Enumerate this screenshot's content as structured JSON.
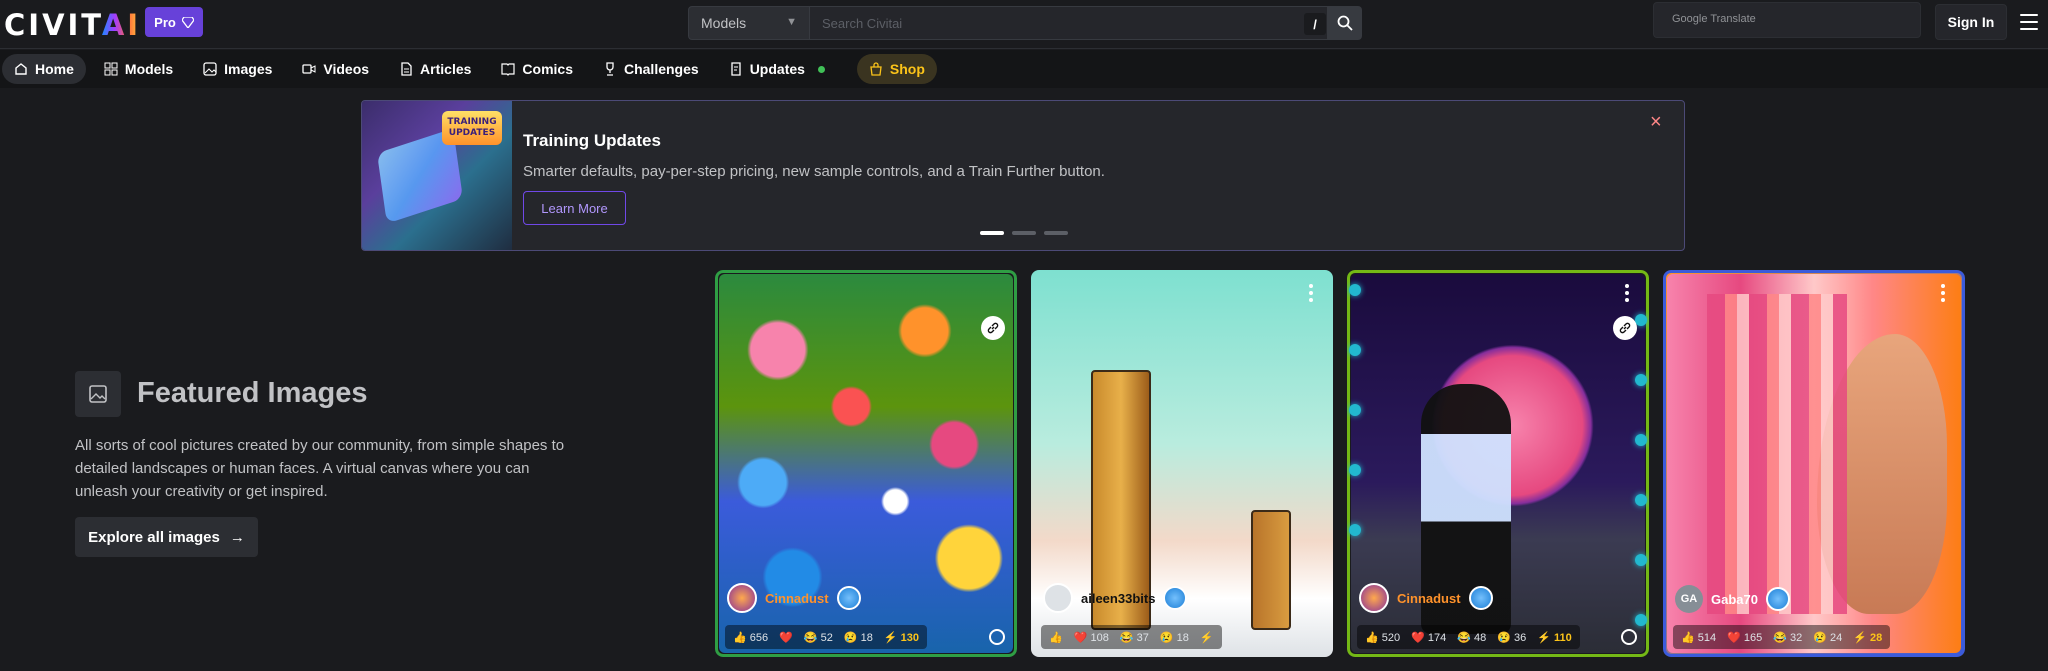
{
  "header": {
    "logo_main": "CIVIT",
    "logo_ai": "AI",
    "pro_label": "Pro",
    "search_scope": "Models",
    "search_placeholder": "Search Civitai",
    "search_shortcut": "/",
    "translate_label": "Google Translate",
    "signin_label": "Sign In"
  },
  "nav": {
    "items": [
      {
        "label": "Home",
        "icon": "home-icon"
      },
      {
        "label": "Models",
        "icon": "grid-icon"
      },
      {
        "label": "Images",
        "icon": "image-icon"
      },
      {
        "label": "Videos",
        "icon": "video-icon"
      },
      {
        "label": "Articles",
        "icon": "article-icon"
      },
      {
        "label": "Comics",
        "icon": "book-icon"
      },
      {
        "label": "Challenges",
        "icon": "trophy-icon"
      },
      {
        "label": "Updates",
        "icon": "updates-icon"
      },
      {
        "label": "Shop",
        "icon": "shopping-bag-icon"
      }
    ]
  },
  "banner": {
    "image_tag": "TRAINING UPDATES",
    "title": "Training Updates",
    "text": "Smarter defaults, pay-per-step pricing, new sample controls, and a Train Further button.",
    "cta": "Learn More",
    "close": "×"
  },
  "featured": {
    "title": "Featured Images",
    "description": "All sorts of cool pictures created by our community, from simple shapes to detailed landscapes or human faces. A virtual canvas where you can unleash your creativity or get inspired.",
    "cta": "Explore all images",
    "cta_arrow": "→"
  },
  "cards": [
    {
      "user": "Cinnadust",
      "likes": "656",
      "hearts": "",
      "laughs": "52",
      "cries": "18",
      "buzz": "130",
      "frame_color": "#2f9e44"
    },
    {
      "user": "aileen33bits",
      "likes": "",
      "hearts": "108",
      "laughs": "37",
      "cries": "18",
      "buzz": "",
      "frame_color": "none"
    },
    {
      "user": "Cinnadust",
      "likes": "520",
      "hearts": "174",
      "laughs": "48",
      "cries": "36",
      "buzz": "110",
      "frame_color": "#74b816"
    },
    {
      "user": "Gaba70",
      "avatar_initials": "GA",
      "likes": "514",
      "hearts": "165",
      "laughs": "32",
      "cries": "24",
      "buzz": "28",
      "frame_color": "#3b5bdb"
    }
  ],
  "colors": {
    "accent": "#6741d9",
    "shop": "#fcc419",
    "background": "#1a1b1e"
  }
}
